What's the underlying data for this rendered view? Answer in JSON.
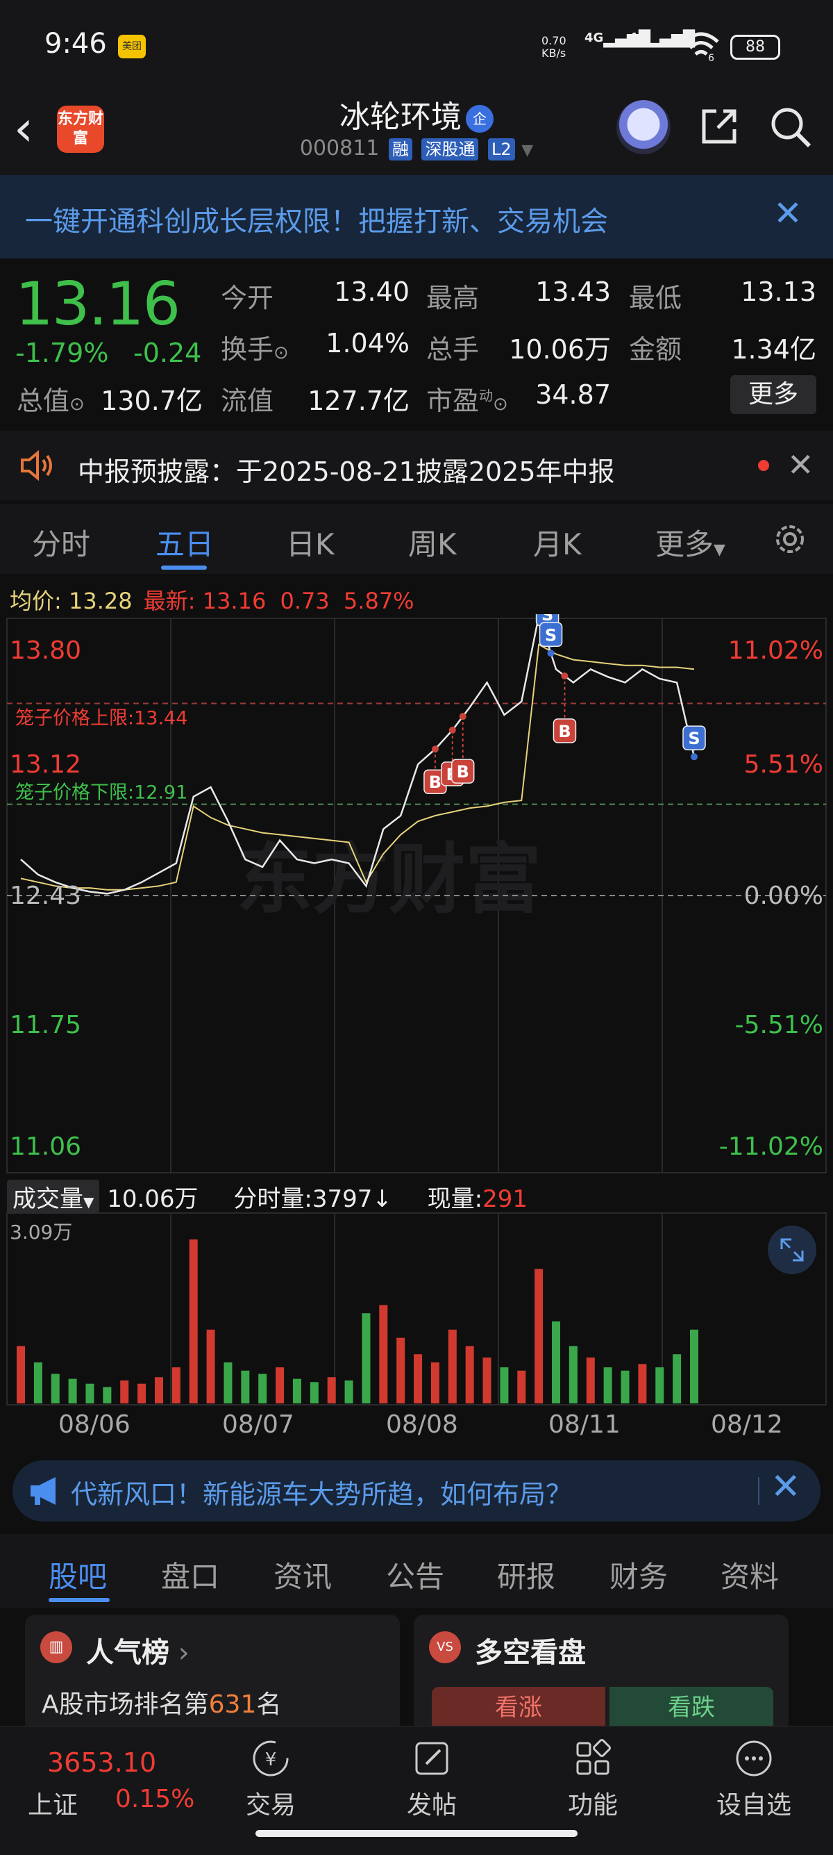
{
  "status_bar": {
    "time": "9:46",
    "app_badge": "美团",
    "net_speed_value": "0.70",
    "net_speed_unit": "KB/s",
    "signal1": "4G",
    "signal2": "4G",
    "wifi_label": "6",
    "battery": "88"
  },
  "header": {
    "logo_text": "东方财富",
    "stock_name": "冰轮环境",
    "name_badge": "企",
    "stock_code": "000811",
    "tags": [
      "融",
      "深股通",
      "L2"
    ]
  },
  "promo_banner": {
    "text": "一键开通科创成长层权限！把握打新、交易机会"
  },
  "quote": {
    "price": "13.16",
    "change_pct": "-1.79%",
    "change": "-0.24",
    "rows": [
      [
        {
          "label": "今开",
          "value": "13.40",
          "color": "#eeeeee"
        },
        {
          "label": "最高",
          "value": "13.43",
          "color": "#f03c33"
        },
        {
          "label": "最低",
          "value": "13.13",
          "color": "#3ec04b"
        }
      ],
      [
        {
          "label": "换手",
          "value": "1.04%",
          "color": "#eeeeee"
        },
        {
          "label": "总手",
          "value": "10.06万",
          "color": "#eeeeee"
        },
        {
          "label": "金额",
          "value": "1.34亿",
          "color": "#eeeeee"
        }
      ]
    ],
    "row3": {
      "total_value_label": "总值",
      "total_value": "130.7亿",
      "float_label": "流值",
      "float_value": "127.7亿",
      "pe_label": "市盈",
      "pe_sup": "动",
      "pe_value": "34.87"
    },
    "more_button": "更多"
  },
  "notice": {
    "text": "中报预披露：于2025-08-21披露2025年中报"
  },
  "period_tabs": {
    "items": [
      "分时",
      "五日",
      "日K",
      "周K",
      "月K",
      "更多"
    ],
    "active": 1
  },
  "legend": {
    "avg_label": "均价:",
    "avg_value": "13.28",
    "latest_label": "最新:",
    "latest_value": "13.16",
    "change": "0.73",
    "change_pct": "5.87%"
  },
  "chart_data": {
    "type": "line",
    "x": [
      "08/06",
      "08/07",
      "08/08",
      "08/11",
      "08/12"
    ],
    "y_left_ticks": [
      "13.80",
      "13.12",
      "12.43",
      "11.75",
      "11.06"
    ],
    "y_right_ticks": [
      "11.02%",
      "5.51%",
      "0.00%",
      "-5.51%",
      "-11.02%"
    ],
    "ylim": [
      11.06,
      13.8
    ],
    "reference_price": 12.43,
    "cage_upper": {
      "label": "笼子价格上限:",
      "value": "13.44"
    },
    "cage_lower": {
      "label": "笼子价格下限:",
      "value": "12.91"
    },
    "watermark": "东方财富",
    "series": [
      {
        "name": "price",
        "color": "#e8e8e8",
        "values": [
          12.62,
          12.54,
          12.5,
          12.47,
          12.45,
          12.44,
          12.46,
          12.5,
          12.55,
          12.6,
          12.95,
          13.0,
          12.82,
          12.62,
          12.58,
          12.72,
          12.62,
          12.6,
          12.62,
          12.6,
          12.48,
          12.78,
          12.85,
          13.12,
          13.2,
          13.3,
          13.42,
          13.55,
          13.38,
          13.45,
          13.9,
          13.62,
          13.55,
          13.62,
          13.58,
          13.55,
          13.62,
          13.57,
          13.55,
          13.16
        ]
      },
      {
        "name": "avg",
        "color": "#e7d37a",
        "values": [
          12.52,
          12.5,
          12.48,
          12.47,
          12.47,
          12.46,
          12.46,
          12.47,
          12.48,
          12.5,
          12.9,
          12.84,
          12.8,
          12.78,
          12.76,
          12.75,
          12.74,
          12.73,
          12.72,
          12.71,
          12.5,
          12.65,
          12.75,
          12.82,
          12.85,
          12.87,
          12.89,
          12.9,
          12.92,
          12.93,
          13.75,
          13.7,
          13.67,
          13.66,
          13.65,
          13.64,
          13.64,
          13.63,
          13.63,
          13.62
        ]
      }
    ],
    "trade_markers": [
      {
        "type": "B",
        "x_index": 24
      },
      {
        "type": "B",
        "x_index": 25
      },
      {
        "type": "B",
        "x_index": 25.6
      },
      {
        "type": "S",
        "x_index": 30.5
      },
      {
        "type": "S",
        "x_index": 30.7
      },
      {
        "type": "B",
        "x_index": 31.5
      },
      {
        "type": "S",
        "x_index": 39
      }
    ]
  },
  "volume": {
    "label": "成交量",
    "total": "10.06万",
    "minute_vol_label": "分时量:",
    "minute_vol": "3797",
    "current_label": "现量:",
    "current": "291",
    "max_tick": "3.09万",
    "bars": [
      0.35,
      0.25,
      0.18,
      0.15,
      0.12,
      0.1,
      0.14,
      0.12,
      0.16,
      0.22,
      1.0,
      0.45,
      0.25,
      0.2,
      0.18,
      0.22,
      0.15,
      0.13,
      0.16,
      0.14,
      0.55,
      0.6,
      0.4,
      0.3,
      0.25,
      0.45,
      0.35,
      0.28,
      0.22,
      0.2,
      0.82,
      0.5,
      0.35,
      0.28,
      0.22,
      0.2,
      0.24,
      0.22,
      0.3,
      0.45
    ]
  },
  "ad_banner": {
    "text": "代新风口！新能源车大势所趋，如何布局？"
  },
  "sub_tabs": {
    "items": [
      "股吧",
      "盘口",
      "资讯",
      "公告",
      "研报",
      "财务",
      "资料"
    ],
    "active": 0
  },
  "cards": {
    "popularity": {
      "title": "人气榜",
      "sub_prefix": "A股市场排名第",
      "rank": "631",
      "sub_suffix": "名"
    },
    "bull_bear": {
      "title": "多空看盘",
      "up": "看涨",
      "down": "看跌"
    }
  },
  "bottom_nav": {
    "index_value": "3653.10",
    "index_name": "上证",
    "index_pct": "0.15%",
    "items": [
      "交易",
      "发帖",
      "功能",
      "设自选"
    ]
  }
}
